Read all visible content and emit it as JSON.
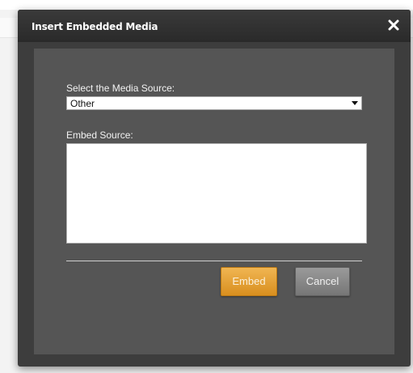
{
  "dialog": {
    "title": "Insert Embedded Media",
    "close_icon": "close-icon"
  },
  "form": {
    "media_source_label": "Select the Media Source:",
    "media_source_value": "Other",
    "embed_source_label": "Embed Source:",
    "embed_source_value": ""
  },
  "buttons": {
    "embed_label": "Embed",
    "cancel_label": "Cancel"
  },
  "colors": {
    "accent": "#e3a13a",
    "dialog_bg": "#3d3d3d",
    "body_bg": "#555555"
  }
}
